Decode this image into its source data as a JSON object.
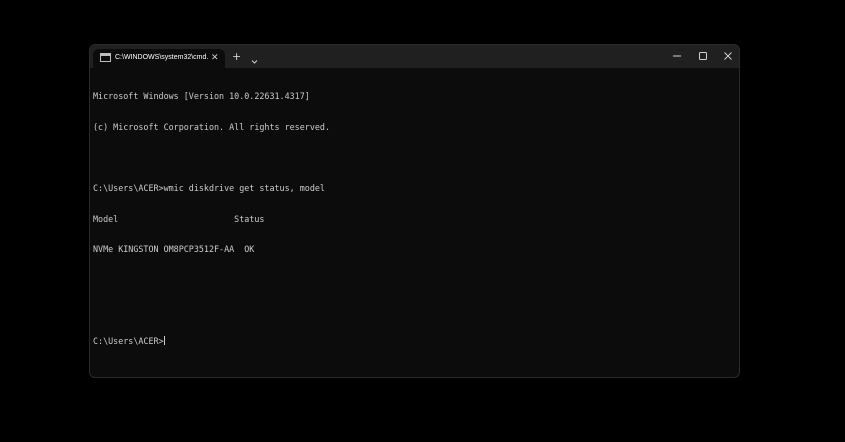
{
  "window": {
    "tab": {
      "title": "C:\\WINDOWS\\system32\\cmd.",
      "icon": "cmd-icon",
      "close_label": "✕"
    },
    "new_tab_label": "+",
    "dropdown_icon": "chevron-down-icon",
    "controls": {
      "minimize_icon": "minimize-icon",
      "maximize_icon": "maximize-icon",
      "close_icon": "close-icon"
    }
  },
  "terminal": {
    "lines": [
      "Microsoft Windows [Version 10.0.22631.4317]",
      "(c) Microsoft Corporation. All rights reserved.",
      "",
      "C:\\Users\\ACER>wmic diskdrive get status, model",
      "Model                       Status",
      "NVMe KINGSTON OM8PCP3512F-AA  OK",
      "",
      "",
      "C:\\Users\\ACER>"
    ]
  },
  "colors": {
    "background": "#000000",
    "terminal_bg": "#0c0c0c",
    "titlebar_bg": "#202020",
    "text": "#cccccc"
  }
}
